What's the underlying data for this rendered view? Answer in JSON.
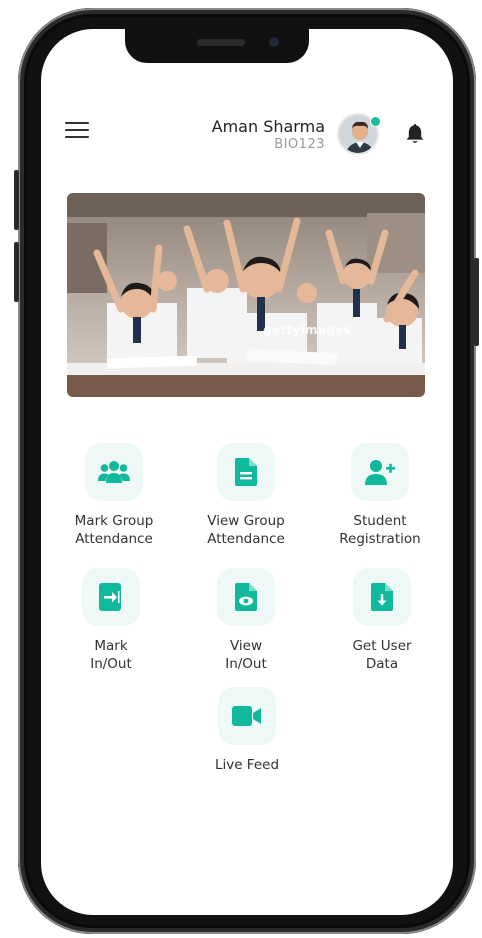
{
  "header": {
    "user_name": "Aman Sharma",
    "user_id": "BIO123",
    "menu_icon": "hamburger-menu-icon",
    "notification_icon": "bell-icon",
    "online_status_color": "#1abc9c"
  },
  "banner": {
    "watermark": "gettyimages"
  },
  "accent_color": "#10b99b",
  "tiles": [
    {
      "label": "Mark Group\nAttendance",
      "icon": "group-users-icon"
    },
    {
      "label": "View Group\nAttendance",
      "icon": "document-list-icon"
    },
    {
      "label": "Student\nRegistration",
      "icon": "add-user-icon"
    },
    {
      "label": "Mark\nIn/Out",
      "icon": "sign-in-icon"
    },
    {
      "label": "View\nIn/Out",
      "icon": "file-view-icon"
    },
    {
      "label": "Get User\nData",
      "icon": "file-download-icon"
    },
    {
      "label": "Live Feed",
      "icon": "video-camera-icon"
    }
  ]
}
